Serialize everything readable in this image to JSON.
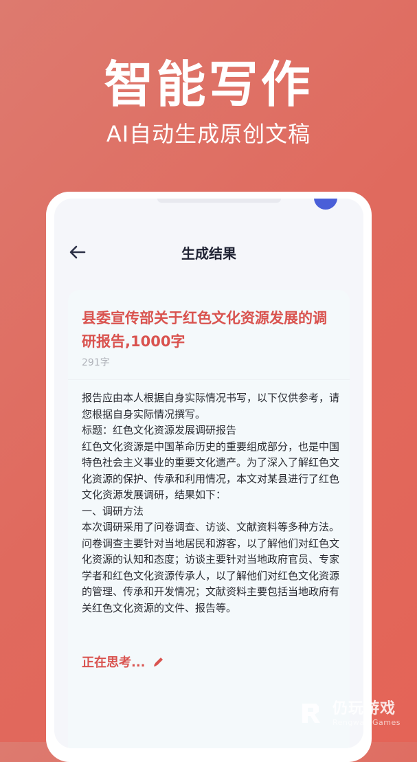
{
  "hero": {
    "title": "智能写作",
    "subtitle": "AI自动生成原创文稿"
  },
  "app": {
    "page_title": "生成结果",
    "back_icon": "arrow-left-icon",
    "result": {
      "title": "县委宣传部关于红色文化资源发展的调研报告,1000字",
      "word_count": "291字",
      "paragraphs": [
        "报告应由本人根据自身实际情况书写，以下仅供参考，请您根据自身实际情况撰写。",
        "标题：红色文化资源发展调研报告",
        "红色文化资源是中国革命历史的重要组成部分，也是中国特色社会主义事业的重要文化遗产。为了深入了解红色文化资源的保护、传承和利用情况，本文对某县进行了红色文化资源发展调研，结果如下：",
        "一、调研方法",
        "本次调研采用了问卷调查、访谈、文献资料等多种方法。问卷调查主要针对当地居民和游客，以了解他们对红色文化资源的认知和态度；访谈主要针对当地政府官员、专家学者和红色文化资源传承人，以了解他们对红色文化资源的管理、传承和开发情况；文献资料主要包括当地政府有关红色文化资源的文件、报告等。"
      ],
      "status": "正在思考...",
      "status_icon": "pencil-icon"
    }
  },
  "watermark": {
    "cn": "仍玩游戏",
    "en": "Rengwan Games"
  },
  "colors": {
    "background": "#e06a5e",
    "accent": "#d9534f",
    "blue_dot": "#4a5fd8"
  }
}
